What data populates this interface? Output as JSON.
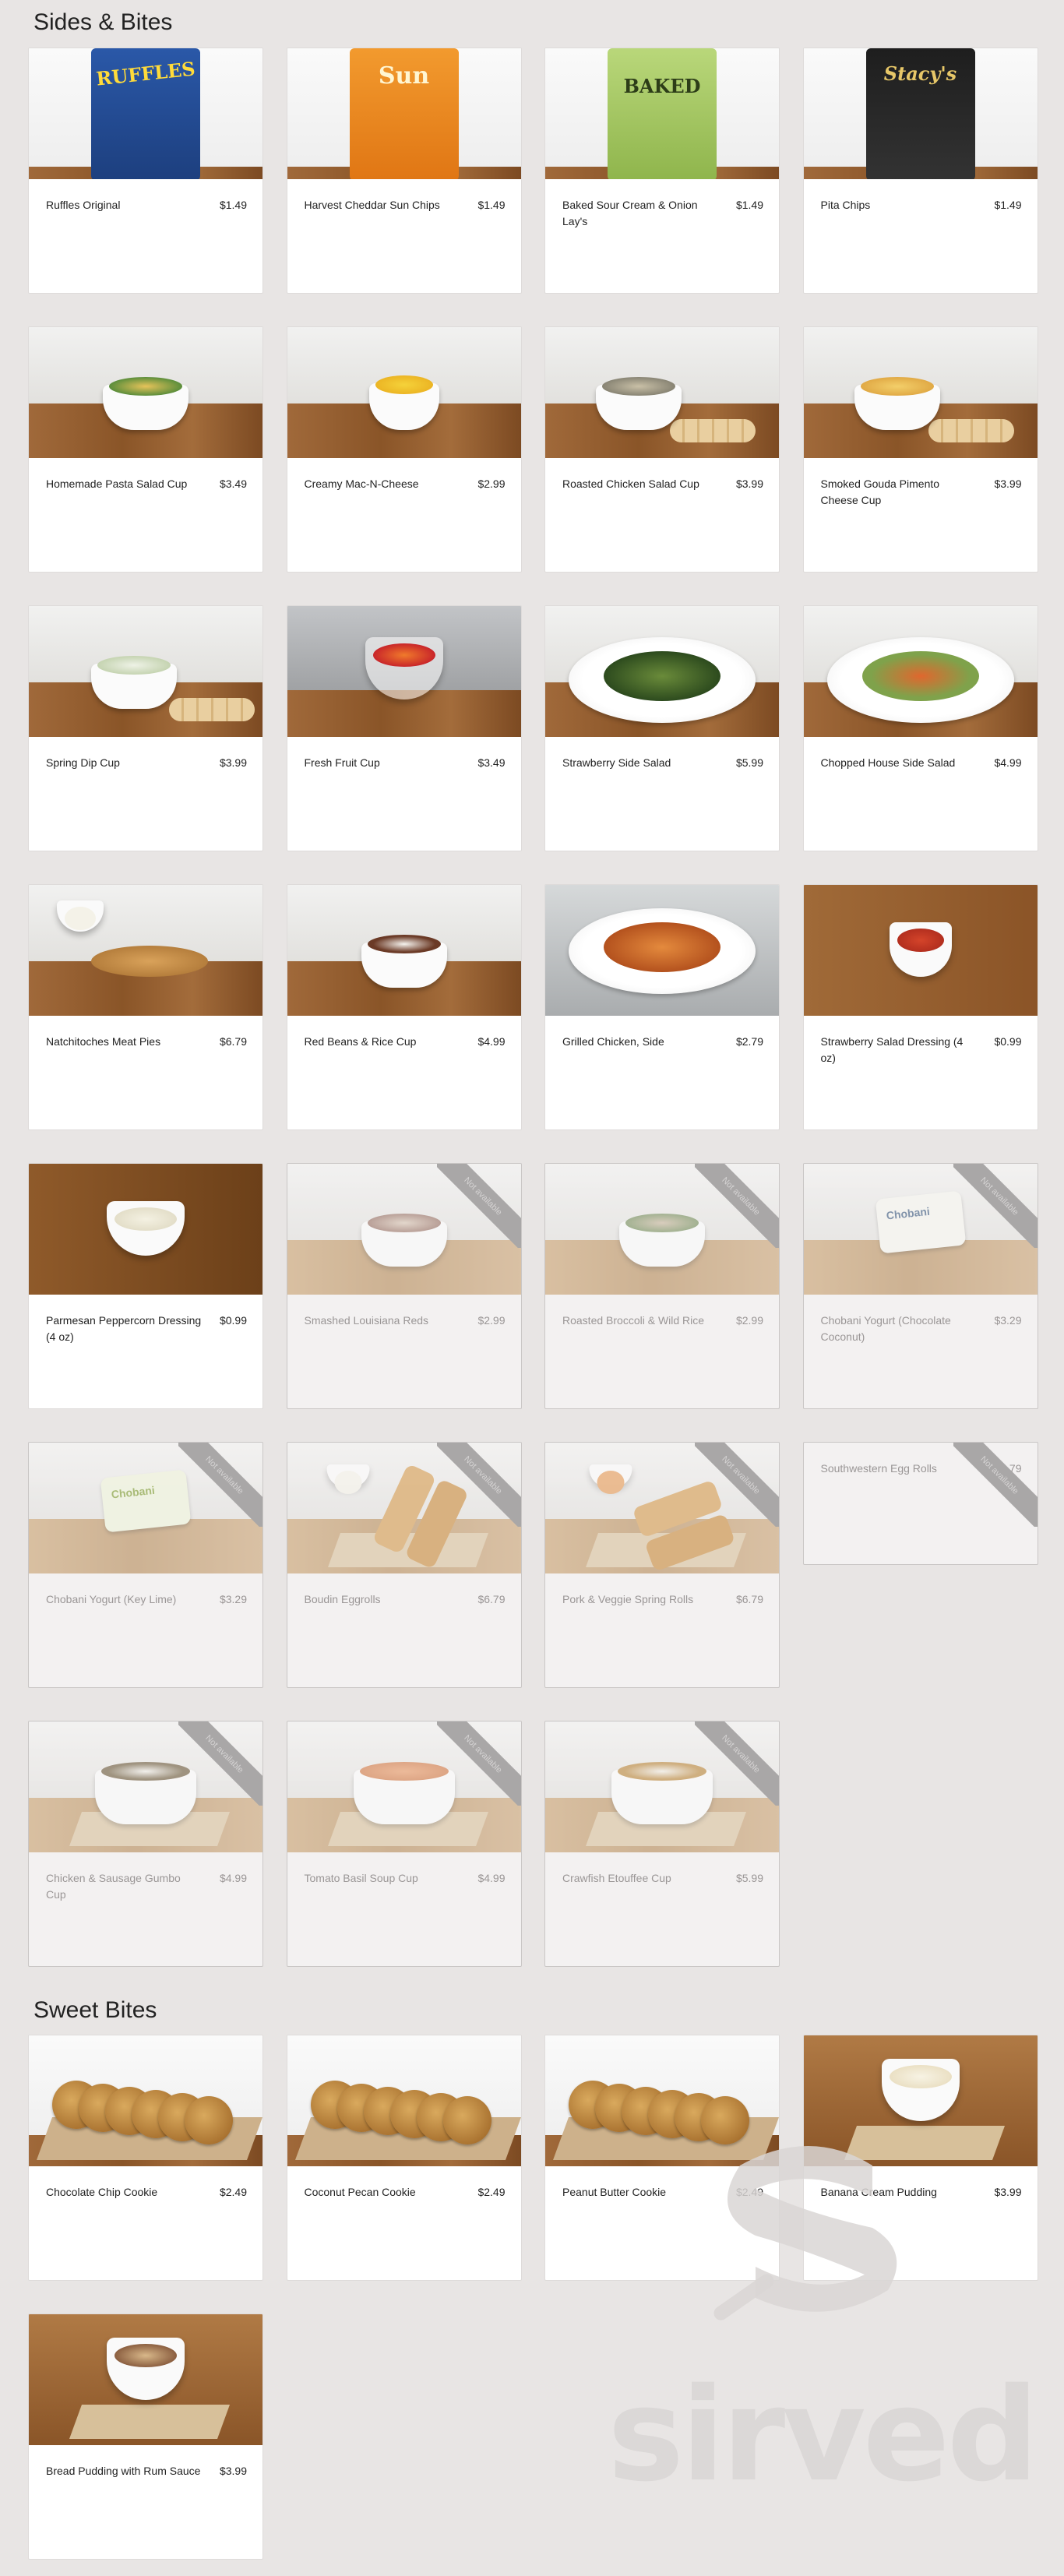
{
  "sections": [
    {
      "title": "Sides & Bites",
      "items": [
        {
          "name": "Ruffles Original",
          "price": "$1.49",
          "available": true,
          "image": "ruffles-bag"
        },
        {
          "name": "Harvest Cheddar Sun Chips",
          "price": "$1.49",
          "available": true,
          "image": "sunchips-bag"
        },
        {
          "name": "Baked Sour Cream & Onion Lay's",
          "price": "$1.49",
          "available": true,
          "image": "lays-bag"
        },
        {
          "name": "Pita Chips",
          "price": "$1.49",
          "available": true,
          "image": "stacys-bag"
        },
        {
          "name": "Homemade Pasta Salad Cup",
          "price": "$3.49",
          "available": true,
          "image": "pasta-bowl"
        },
        {
          "name": "Creamy Mac-N-Cheese",
          "price": "$2.99",
          "available": true,
          "image": "mac-bowl"
        },
        {
          "name": "Roasted Chicken Salad Cup",
          "price": "$3.99",
          "available": true,
          "image": "chicken-salad-bowl"
        },
        {
          "name": "Smoked Gouda Pimento Cheese Cup",
          "price": "$3.99",
          "available": true,
          "image": "pimento-bowl"
        },
        {
          "name": "Spring Dip Cup",
          "price": "$3.99",
          "available": true,
          "image": "dip-bowl"
        },
        {
          "name": "Fresh Fruit Cup",
          "price": "$3.49",
          "available": true,
          "image": "fruit-cup"
        },
        {
          "name": "Strawberry Side Salad",
          "price": "$5.99",
          "available": true,
          "image": "strawberry-salad-plate"
        },
        {
          "name": "Chopped House Side Salad",
          "price": "$4.99",
          "available": true,
          "image": "house-salad-plate"
        },
        {
          "name": "Natchitoches Meat Pies",
          "price": "$6.79",
          "available": true,
          "image": "meat-pies"
        },
        {
          "name": "Red Beans & Rice Cup",
          "price": "$4.99",
          "available": true,
          "image": "red-beans-bowl"
        },
        {
          "name": "Grilled Chicken, Side",
          "price": "$2.79",
          "available": true,
          "image": "grilled-chicken-plate"
        },
        {
          "name": "Strawberry Salad Dressing (4 oz)",
          "price": "$0.99",
          "available": true,
          "image": "red-dressing-cup"
        },
        {
          "name": "Parmesan Peppercorn Dressing (4 oz)",
          "price": "$0.99",
          "available": true,
          "image": "white-dressing-cup"
        },
        {
          "name": "Smashed Louisiana Reds",
          "price": "$2.99",
          "available": false,
          "image": "reds-bowl"
        },
        {
          "name": "Roasted Broccoli & Wild Rice",
          "price": "$2.99",
          "available": false,
          "image": "broccoli-rice-bowl"
        },
        {
          "name": "Chobani Yogurt (Chocolate Coconut)",
          "price": "$3.29",
          "available": false,
          "image": "chobani-cup"
        },
        {
          "name": "Chobani Yogurt (Key Lime)",
          "price": "$3.29",
          "available": false,
          "image": "chobani-keylime-cup"
        },
        {
          "name": "Boudin Eggrolls",
          "price": "$6.79",
          "available": false,
          "image": "eggrolls"
        },
        {
          "name": "Pork & Veggie Spring Rolls",
          "price": "$6.79",
          "available": false,
          "image": "spring-rolls"
        },
        {
          "name": "Southwestern Egg Rolls",
          "price": "$6.79",
          "available": false,
          "image": "none"
        },
        {
          "name": "Chicken & Sausage Gumbo Cup",
          "price": "$4.99",
          "available": false,
          "image": "gumbo-bowl"
        },
        {
          "name": "Tomato Basil Soup Cup",
          "price": "$4.99",
          "available": false,
          "image": "tomato-soup-bowl"
        },
        {
          "name": "Crawfish Etouffee Cup",
          "price": "$5.99",
          "available": false,
          "image": "etouffee-bowl"
        }
      ]
    },
    {
      "title": "Sweet Bites",
      "items": [
        {
          "name": "Chocolate Chip Cookie",
          "price": "$2.49",
          "available": true,
          "image": "cookies"
        },
        {
          "name": "Coconut Pecan Cookie",
          "price": "$2.49",
          "available": true,
          "image": "cookies"
        },
        {
          "name": "Peanut Butter Cookie",
          "price": "$2.49",
          "available": true,
          "image": "cookies"
        },
        {
          "name": "Banana Cream Pudding",
          "price": "$3.99",
          "available": true,
          "image": "pudding-bowl"
        },
        {
          "name": "Bread Pudding with Rum Sauce",
          "price": "$3.99",
          "available": true,
          "image": "bread-pudding-bowl"
        }
      ]
    }
  ],
  "unavailable_label": "Not available",
  "watermark": "sirved",
  "colors": {
    "page_bg": "#e8e5e4",
    "card_bg": "#ffffff",
    "unavailable_bg": "#f3f1f1",
    "ribbon": "#a9a7a7"
  }
}
